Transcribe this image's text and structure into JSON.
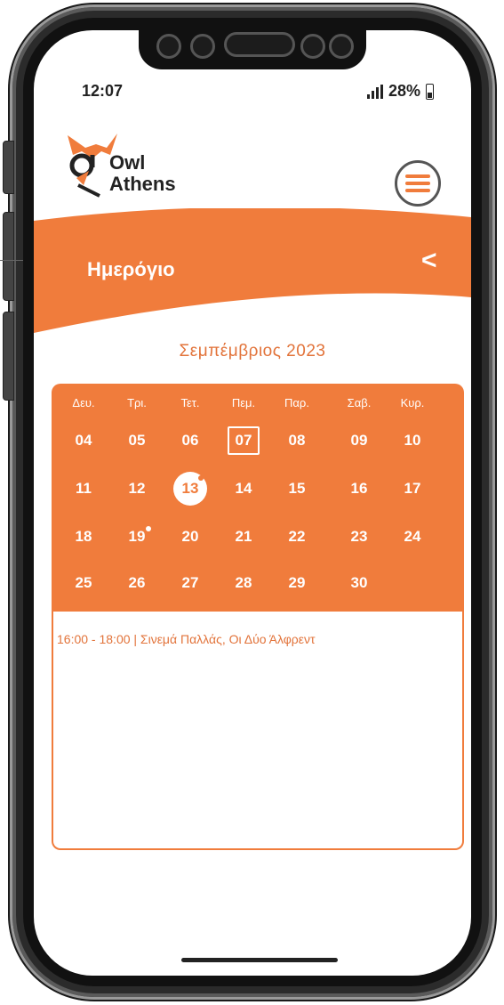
{
  "status_bar": {
    "time": "12:07",
    "battery": "28%"
  },
  "logo": {
    "line1": "Owl",
    "line2": "Athens"
  },
  "header": {
    "title": "Ημερόγιο",
    "back_icon": "<"
  },
  "calendar": {
    "month": "Σεμπέμβριος  2023",
    "weekdays": [
      "Δευ.",
      "Τρι.",
      "Τετ.",
      "Πεμ.",
      "Παρ.",
      "Σαβ.",
      "Κυρ."
    ],
    "weeks": [
      [
        "04",
        "05",
        "06",
        "07",
        "08",
        "09",
        "10"
      ],
      [
        "11",
        "12",
        "13",
        "14",
        "15",
        "16",
        "17"
      ],
      [
        "18",
        "19",
        "20",
        "21",
        "22",
        "23",
        "24"
      ],
      [
        "25",
        "26",
        "27",
        "28",
        "29",
        "30",
        ""
      ]
    ],
    "outlined_day": "07",
    "selected_day": "13",
    "event_days": [
      "13",
      "19"
    ]
  },
  "events": [
    {
      "text": "16:00 - 18:00 | Σινεμά Παλλάς, Οι Δύο Άλφρεντ"
    }
  ],
  "colors": {
    "accent": "#f07c3c",
    "accent_text": "#e2733a"
  },
  "icons": {
    "menu": "hamburger-menu-icon",
    "back": "chevron-left-icon",
    "signal": "signal-icon",
    "battery": "battery-icon"
  }
}
